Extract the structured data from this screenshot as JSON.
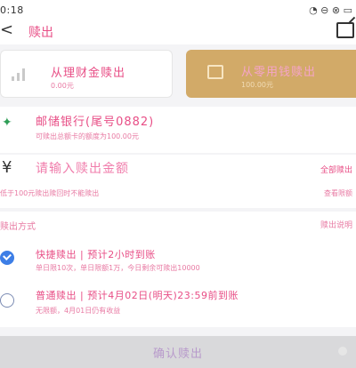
{
  "status_bar": {
    "time": "0:18",
    "icons_text": "◔ ⊖ ⊗ ▭"
  },
  "header": {
    "back_glyph": "<",
    "title": "赎出"
  },
  "redeem_to": {
    "wealth": {
      "label": "从理财金赎出",
      "sub": "0.00元"
    },
    "flexible": {
      "label": "从零用钱赎出",
      "sub": "100.00元"
    }
  },
  "bank": {
    "name": "邮储银行(尾号0882)",
    "limit_text": "可赎出总额卡的额度为100.00元"
  },
  "amount": {
    "currency_symbol": "¥",
    "placeholder": "请输入赎出金额",
    "all_label": "全部赎出",
    "note": "低于100元赎出赎回时不能赎出",
    "more_label": "查看限额"
  },
  "method": {
    "section_title": "赎出方式",
    "rules_label": "赎出说明",
    "options": [
      {
        "title": "快捷赎出 | 预计2小时到账",
        "sub": "单日限10次，单日限额1万，今日剩余可赎出10000",
        "selected": true
      },
      {
        "title": "普通赎出 | 预计4月02日(明天)23:59前到账",
        "sub": "无限额，4月01日仍有收益",
        "selected": false
      }
    ]
  },
  "confirm": {
    "label": "确认赎出"
  },
  "colors": {
    "accent": "#e84e86",
    "gold": "#d2aa68",
    "radio_blue": "#3d7ee6",
    "bank_green": "#2f9e57"
  }
}
